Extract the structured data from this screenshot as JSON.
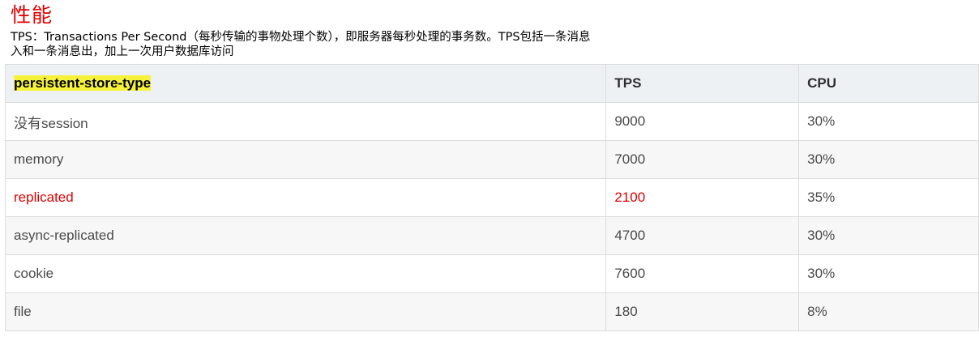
{
  "title": "性能",
  "description": {
    "line1": "TPS：Transactions Per Second（每秒传输的事物处理个数），即服务器每秒处理的事务数。TPS包括一条消息",
    "line2": "入和一条消息出，加上一次用户数据库访问"
  },
  "table": {
    "headers": [
      "persistent-store-type",
      "TPS",
      "CPU"
    ],
    "rows": [
      {
        "type": "没有session",
        "tps": "9000",
        "cpu": "30%"
      },
      {
        "type": "memory",
        "tps": "7000",
        "cpu": "30%"
      },
      {
        "type": "replicated",
        "tps": "2100",
        "cpu": "35%"
      },
      {
        "type": "async-replicated",
        "tps": "4700",
        "cpu": "30%"
      },
      {
        "type": "cookie",
        "tps": "7600",
        "cpu": "30%"
      },
      {
        "type": "file",
        "tps": "180",
        "cpu": "8%"
      }
    ]
  },
  "colors": {
    "title": "#e00000",
    "highlight_row": "#e00000",
    "header_highlight": "#f6f23a"
  }
}
